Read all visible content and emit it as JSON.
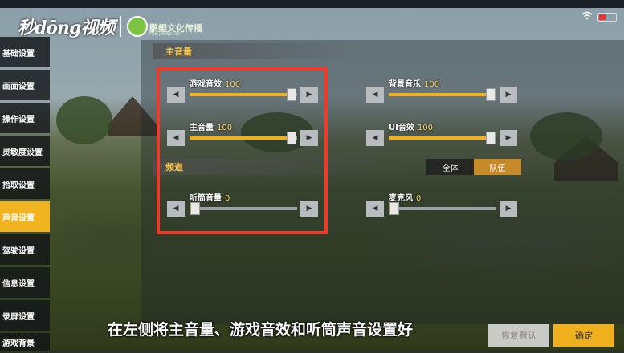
{
  "watermark": {
    "logo": "秒dōng视频",
    "partner": "鹏鲲文化传播",
    "partner_sub": "PENG JUN WEN HUA"
  },
  "status": {
    "wifi_icon": "wifi-icon",
    "battery_icon": "battery-icon"
  },
  "sidebar": {
    "items": [
      {
        "label": "基础设置",
        "active": false
      },
      {
        "label": "画面设置",
        "active": false
      },
      {
        "label": "操作设置",
        "active": false
      },
      {
        "label": "灵敏度设置",
        "active": false
      },
      {
        "label": "拾取设置",
        "active": false
      },
      {
        "label": "声音设置",
        "active": true
      },
      {
        "label": "驾驶设置",
        "active": false
      },
      {
        "label": "信息设置",
        "active": false
      },
      {
        "label": "录屏设置",
        "active": false
      },
      {
        "label": "游戏背景",
        "active": false
      }
    ]
  },
  "master": {
    "title": "主音量",
    "sliders": [
      {
        "label": "游戏音效",
        "value": "100",
        "fraction": 1.0
      },
      {
        "label": "背景音乐",
        "value": "100",
        "fraction": 1.0
      },
      {
        "label": "主音量",
        "value": "100",
        "fraction": 1.0
      },
      {
        "label": "UI音效",
        "value": "100",
        "fraction": 1.0
      }
    ]
  },
  "channel": {
    "title": "频道",
    "options": [
      "全体",
      "队伍"
    ],
    "selected": "队伍",
    "sliders": [
      {
        "label": "听筒音量",
        "value": "0",
        "fraction": 0.0
      },
      {
        "label": "麦克风",
        "value": "0",
        "fraction": 0.0
      }
    ]
  },
  "arrows": {
    "left": "◀",
    "right": "▶"
  },
  "caption": "在左侧将主音量、游戏音效和听筒声音设置好",
  "buttons": {
    "restore": "恢复默认",
    "confirm": "确定"
  },
  "colors": {
    "accent": "#f1b31f",
    "highlight": "#ef3a2a"
  }
}
